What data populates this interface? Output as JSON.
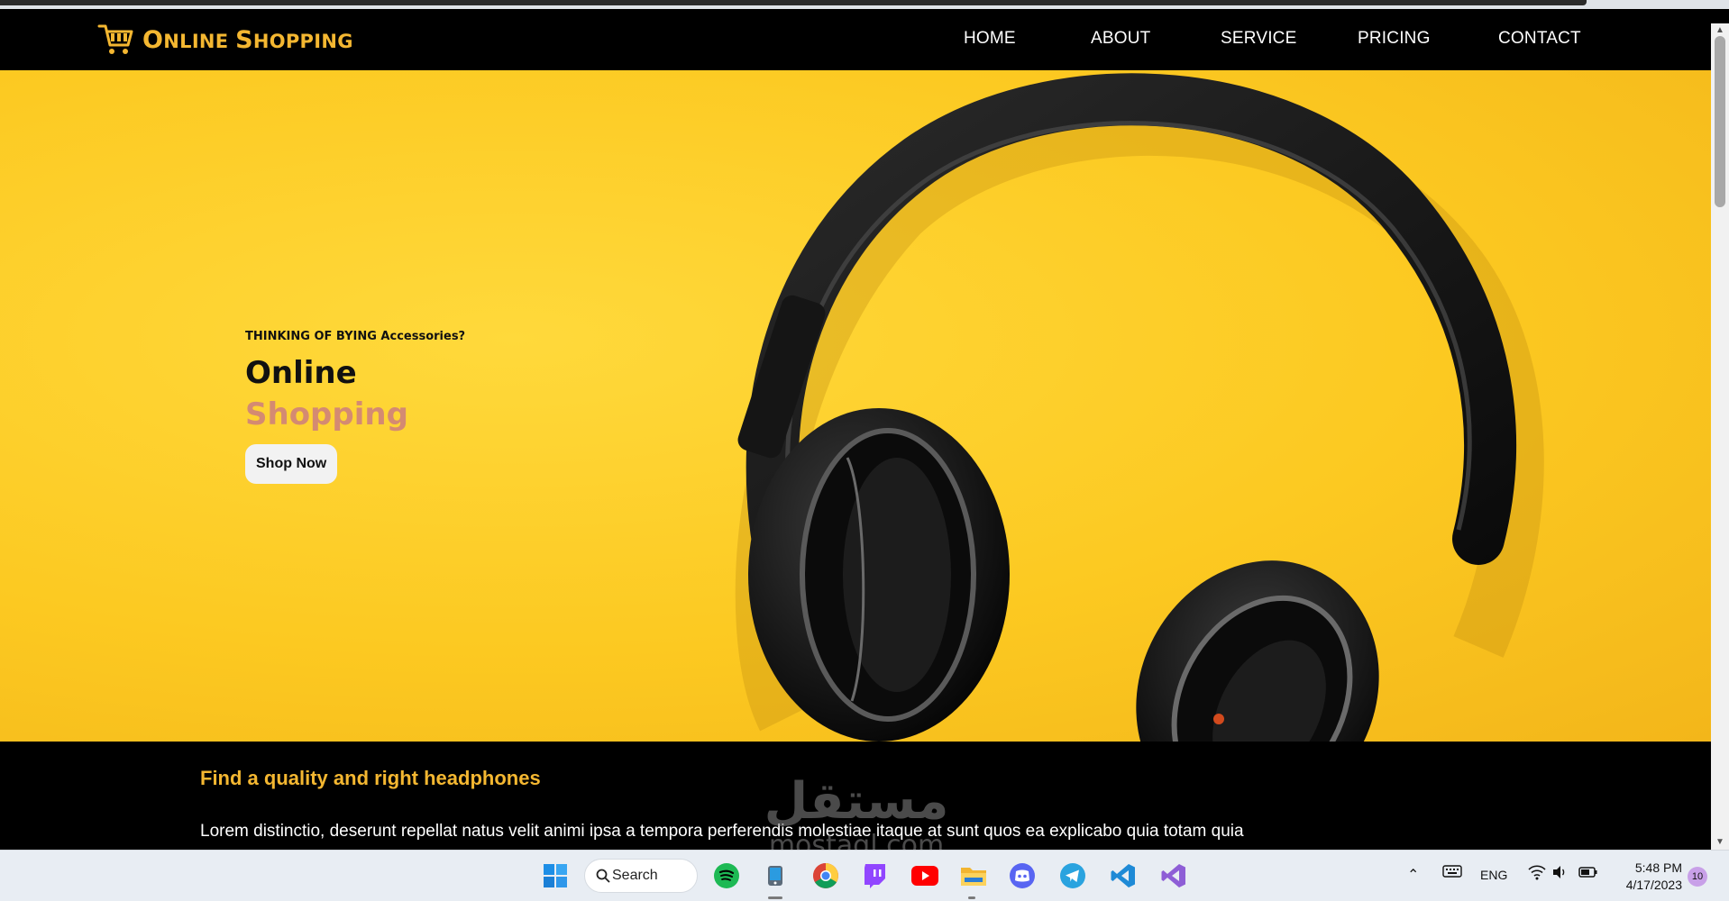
{
  "brand": {
    "word1_cap": "O",
    "word1_rest": "NLINE ",
    "word2_cap": "S",
    "word2_rest": "HOPPING",
    "accent": "#f4b731",
    "icon": "shopping-cart-icon"
  },
  "nav": {
    "items": [
      {
        "label": "HOME"
      },
      {
        "label": "ABOUT"
      },
      {
        "label": "SERVICE"
      },
      {
        "label": "PRICING"
      },
      {
        "label": "CONTACT"
      }
    ]
  },
  "hero": {
    "eyebrow": "THINKING OF BYING Accessories?",
    "title": "Online",
    "subtitle": "Shopping",
    "button": "Shop Now",
    "background": "#fcc921",
    "subtitle_color": "#d48a72"
  },
  "section": {
    "heading": "Find a quality and right headphones",
    "body": "Lorem distinctio, deserunt repellat natus velit animi ipsa a tempora perferendis molestiae itaque at sunt quos ea explicabo quia totam quia"
  },
  "watermark": {
    "arabic": "مستقل",
    "latin": "mostaql.com"
  },
  "taskbar": {
    "search_label": "Search",
    "language": "ENG",
    "time": "5:48 PM",
    "date": "4/17/2023",
    "notifications": "10",
    "apps": [
      "windows-start-icon",
      "search-icon",
      "spotify-icon",
      "file-explorer-icon",
      "chrome-icon",
      "twitch-icon",
      "youtube-icon",
      "folder-icon",
      "discord-icon",
      "telegram-icon",
      "vscode-icon",
      "visual-studio-icon"
    ]
  }
}
